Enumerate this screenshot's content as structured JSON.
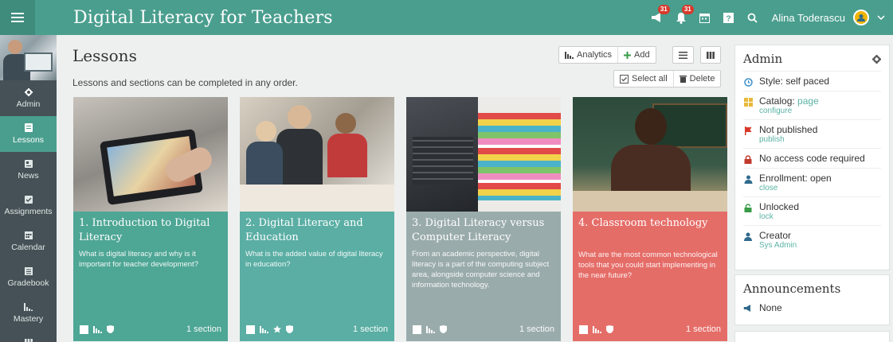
{
  "topbar": {
    "course_title": "Digital Literacy for Teachers",
    "badge_notifications": "31",
    "badge_alerts": "31",
    "user_name": "Alina Toderascu"
  },
  "sidebar": {
    "items": [
      {
        "label": "Admin",
        "icon": "gear-icon"
      },
      {
        "label": "Lessons",
        "icon": "lessons-icon"
      },
      {
        "label": "News",
        "icon": "news-icon"
      },
      {
        "label": "Assignments",
        "icon": "assignments-icon"
      },
      {
        "label": "Calendar",
        "icon": "calendar-icon"
      },
      {
        "label": "Gradebook",
        "icon": "gradebook-icon"
      },
      {
        "label": "Mastery",
        "icon": "mastery-icon"
      }
    ]
  },
  "main": {
    "title": "Lessons",
    "subtitle": "Lessons and sections can be completed in any order.",
    "analytics_label": "Analytics",
    "add_label": "Add",
    "select_all_label": "Select all",
    "delete_label": "Delete"
  },
  "cards": [
    {
      "title": "1. Introduction to Digital Literacy",
      "desc": "What is digital literacy and why is it important for teacher development?",
      "count": "1 section",
      "color": "#4ea695"
    },
    {
      "title": "2. Digital Literacy and Education",
      "desc": "What is the added value of digital literacy in education?",
      "count": "1 section",
      "color": "#5aaea4"
    },
    {
      "title": "3. Digital Literacy versus Computer Literacy",
      "desc": "From an academic perspective, digital literacy is a part of the computing subject area, alongside computer science and information technology.",
      "count": "1 section",
      "color": "#9aabac"
    },
    {
      "title": "4. Classroom technology",
      "desc": "What are the most common technological tools that you could start implementing in the near future?",
      "count": "1 section",
      "color": "#e56d68"
    }
  ],
  "admin": {
    "title": "Admin",
    "style": "Style: self paced",
    "catalog_label": "Catalog:",
    "catalog_link": "page",
    "catalog_sub": "configure",
    "published": "Not published",
    "published_sub": "publish",
    "access": "No access code required",
    "enrollment": "Enrollment: open",
    "enrollment_sub": "close",
    "locked": "Unlocked",
    "locked_sub": "lock",
    "creator": "Creator",
    "creator_sub": "Sys Admin"
  },
  "announcements": {
    "title": "Announcements",
    "value": "None"
  },
  "colors": {
    "brand": "#4a9e8e",
    "sidebar": "#455156",
    "link": "#5bb3a5"
  }
}
